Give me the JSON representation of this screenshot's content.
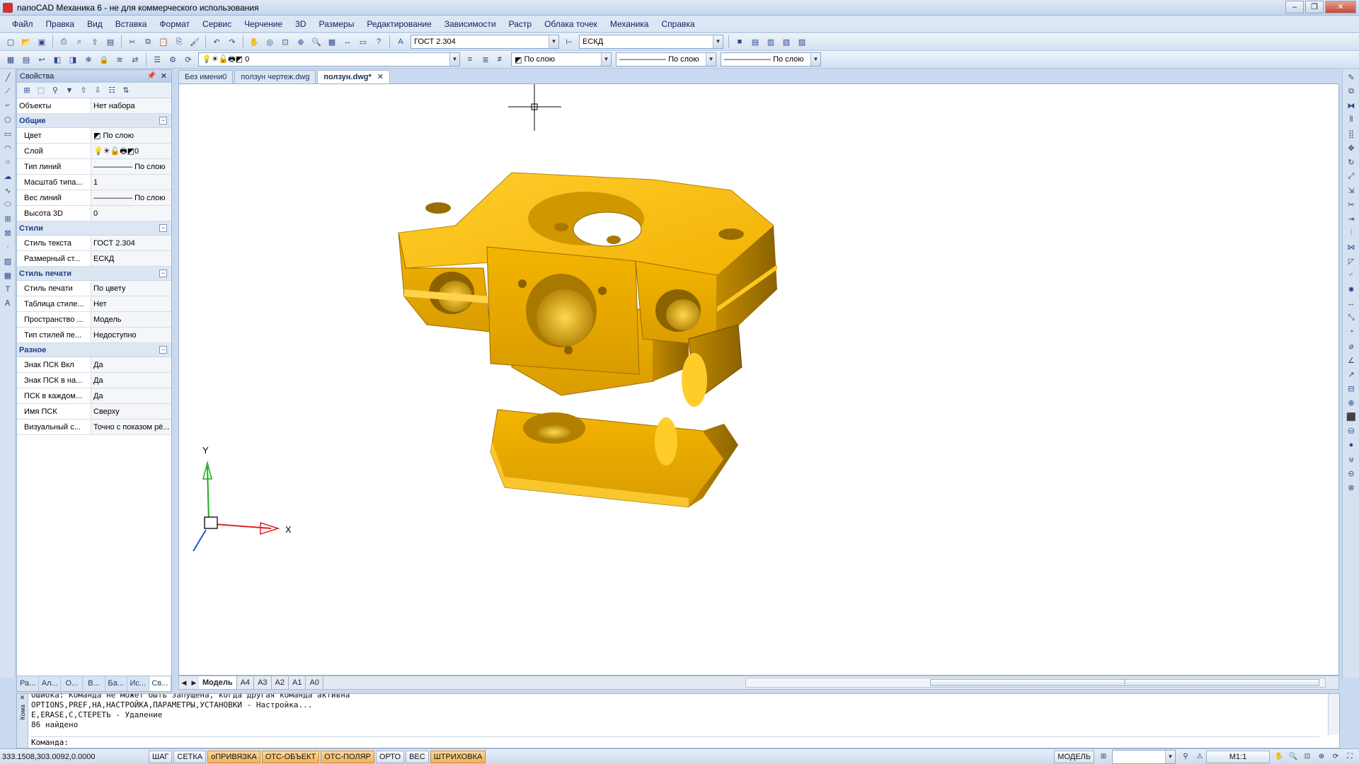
{
  "window": {
    "title": "nanoCAD Механика 6 - не для коммерческого использования",
    "buttons": [
      "–",
      "❐",
      "✕"
    ]
  },
  "menu": [
    "Файл",
    "Правка",
    "Вид",
    "Вставка",
    "Формат",
    "Сервис",
    "Черчение",
    "3D",
    "Размеры",
    "Редактирование",
    "Зависимости",
    "Растр",
    "Облака точек",
    "Механика",
    "Справка"
  ],
  "toolbar": {
    "text_style": "ГОСТ 2.304",
    "dim_style": "ЕСКД",
    "layer": "0",
    "color": "По слою",
    "linetype": "По слою",
    "lineweight": "По слою"
  },
  "properties": {
    "header": "Свойства",
    "objects": {
      "key": "Объекты",
      "value": "Нет набора"
    },
    "sections": [
      {
        "title": "Общие",
        "rows": [
          {
            "key": "Цвет",
            "value": "По слою"
          },
          {
            "key": "Слой",
            "value": "0"
          },
          {
            "key": "Тип линий",
            "value": "По слою"
          },
          {
            "key": "Масштаб типа...",
            "value": "1"
          },
          {
            "key": "Вес линий",
            "value": "По слою"
          },
          {
            "key": "Высота 3D",
            "value": "0"
          }
        ]
      },
      {
        "title": "Стили",
        "rows": [
          {
            "key": "Стиль текста",
            "value": "ГОСТ 2.304"
          },
          {
            "key": "Размерный ст...",
            "value": "ЕСКД"
          }
        ]
      },
      {
        "title": "Стиль печати",
        "rows": [
          {
            "key": "Стиль печати",
            "value": "По цвету"
          },
          {
            "key": "Таблица стиле...",
            "value": "Нет"
          },
          {
            "key": "Пространство ...",
            "value": "Модель"
          },
          {
            "key": "Тип стилей пе...",
            "value": "Недоступно"
          }
        ]
      },
      {
        "title": "Разное",
        "rows": [
          {
            "key": "Знак ПСК Вкл",
            "value": "Да"
          },
          {
            "key": "Знак ПСК в на...",
            "value": "Да"
          },
          {
            "key": "ПСК в каждом...",
            "value": "Да"
          },
          {
            "key": "Имя ПСК",
            "value": "Сверху"
          },
          {
            "key": "Визуальный с...",
            "value": "Точно с показом рё..."
          }
        ]
      }
    ],
    "tabs": [
      "Ра...",
      "Ал...",
      "О...",
      "В...",
      "Ба...",
      "Ис...",
      "Св..."
    ]
  },
  "doc_tabs": [
    {
      "label": "Без имени0",
      "active": false
    },
    {
      "label": "ползун чертеж.dwg",
      "active": false
    },
    {
      "label": "ползун.dwg*",
      "active": true
    }
  ],
  "axes": {
    "x": "X",
    "y": "Y"
  },
  "layout_tabs": [
    "Модель",
    "A4",
    "A3",
    "A2",
    "A1",
    "A0"
  ],
  "command": {
    "lines": [
      "Ошибка: Команда не может быть запущена, когда другая команда активна",
      "OPTIONS,PREF,НА,НАСТРОЙКА,ПАРАМЕТРЫ,УСТАНОВКИ - Настройка...",
      "E,ERASE,С,СТЕРЕТЬ - Удаление",
      "86 найдено"
    ],
    "prompt": "Команда:",
    "side_label": "Кома"
  },
  "status": {
    "coords": "333.1508,303.0092,0.0000",
    "buttons": [
      {
        "label": "ШАГ",
        "on": false
      },
      {
        "label": "СЕТКА",
        "on": false
      },
      {
        "label": "оПРИВЯЗКА",
        "on": true
      },
      {
        "label": "ОТС-ОБЪЕКТ",
        "on": true
      },
      {
        "label": "ОТС-ПОЛЯР",
        "on": true
      },
      {
        "label": "ОРТО",
        "on": false
      },
      {
        "label": "ВЕС",
        "on": false
      },
      {
        "label": "ШТРИХОВКА",
        "on": true
      }
    ],
    "space": "МОДЕЛЬ",
    "scale": "M1:1"
  },
  "colors": {
    "part": "#f5b800",
    "part_dark": "#c88f00",
    "part_light": "#ffd24a",
    "accent_on": "#f0b25c"
  }
}
